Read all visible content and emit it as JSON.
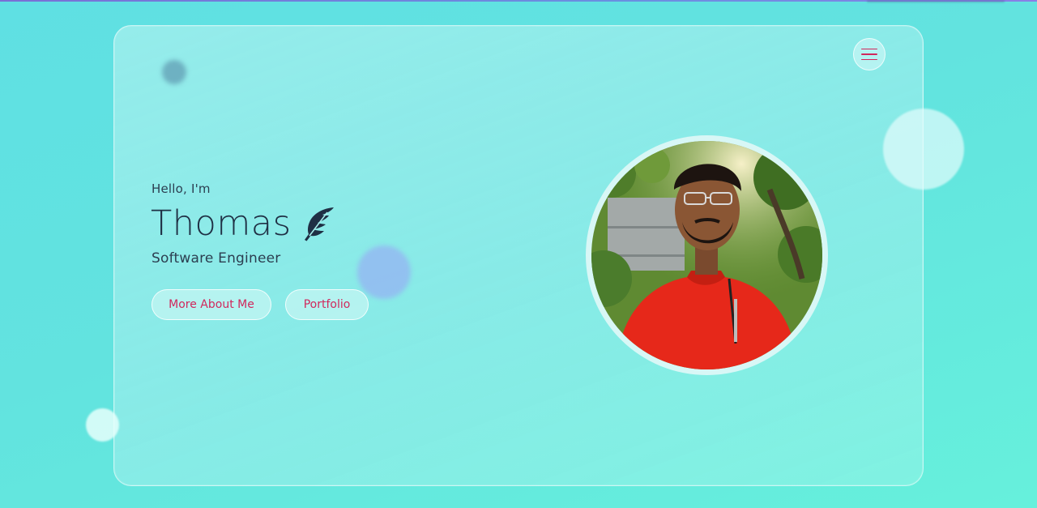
{
  "hero": {
    "greeting": "Hello, I'm",
    "name": "Thomas",
    "title": "Software Engineer"
  },
  "buttons": {
    "more_about_me": "More About Me",
    "portfolio": "Portfolio"
  },
  "icons": {
    "name_icon": "feather-icon",
    "menu_icon": "hamburger-menu-icon"
  },
  "colors": {
    "accent": "#d1285c",
    "text_dark": "#1f2f44",
    "background": "#62e3df"
  }
}
